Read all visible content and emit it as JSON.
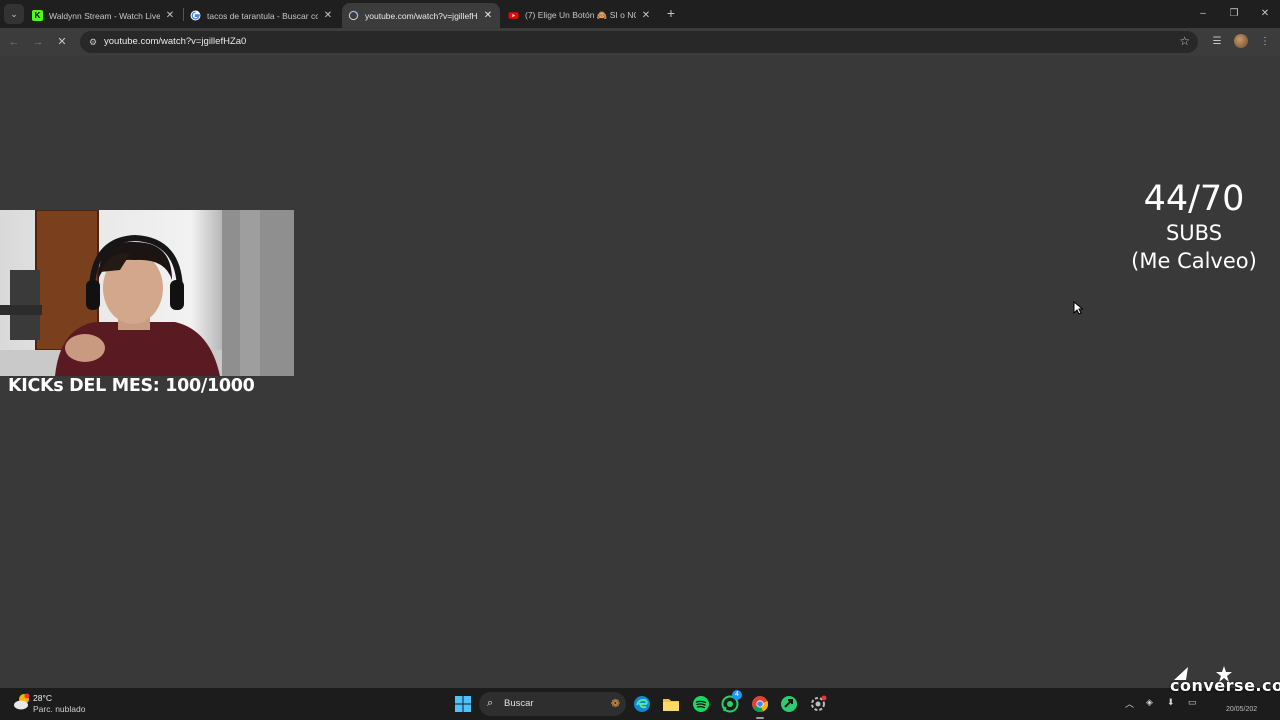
{
  "browser": {
    "tabs": [
      {
        "title": "Waldynn Stream - Watch Live o",
        "favicon": "kick-icon",
        "active": false
      },
      {
        "title": "tacos de tarantula - Buscar con",
        "favicon": "google-icon",
        "active": false
      },
      {
        "title": "youtube.com/watch?v=jgillefHZ",
        "favicon": "loading-globe-icon",
        "active": true
      },
      {
        "title": "(7) Elige Un Botón 🙈 SI o NO |",
        "favicon": "youtube-icon",
        "active": false
      }
    ],
    "tab_close": "✕",
    "new_tab": "+",
    "window_controls": {
      "minimize": "–",
      "maximize": "❐",
      "close": "✕"
    },
    "url": "youtube.com/watch?v=jgillefHZa0"
  },
  "stream": {
    "kicks_goal": "KICKs DEL MES: 100/1000",
    "subs_count": "44/70",
    "subs_label": "SUBS",
    "subs_note": "(Me Calveo)"
  },
  "taskbar": {
    "weather_temp": "28°C",
    "weather_desc": "Parc. nublado",
    "search_placeholder": "Buscar",
    "apps": [
      "edge-icon",
      "file-explorer-icon",
      "spotify-icon",
      "whatsapp-icon",
      "chrome-icon",
      "app-icon",
      "settings-icon"
    ],
    "whatsapp_badge": "4"
  },
  "overlay": {
    "watermark": "converse.co",
    "date_fragment": "20/05/202"
  },
  "colors": {
    "page_bg": "#393939",
    "tabstrip_bg": "#1f1f1f",
    "toolbar_bg": "#3c3c3c",
    "taskbar_bg": "#1c1c1c",
    "spotify": "#1ed760",
    "whatsapp": "#25d366"
  }
}
